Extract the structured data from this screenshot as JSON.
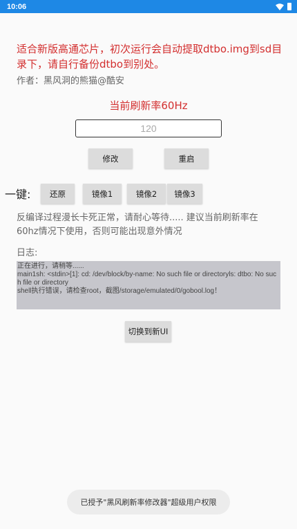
{
  "status_bar": {
    "time": "10:06",
    "wifi_icon": "wifi-icon",
    "battery_icon": "battery-icon",
    "color": "#1e88e5"
  },
  "warning": {
    "text": "适合新版高通芯片，初次运行会自动提取dtbo.img到sd目录下，请自行备份dtbo到别处。",
    "color": "#d32f2f"
  },
  "author": "作者：黑风洞的熊猫@酷安",
  "current_rate": "当前刷新率60Hz",
  "rate_input": {
    "value": "",
    "placeholder": "120"
  },
  "buttons": {
    "modify": "修改",
    "reboot": "重启",
    "restore": "还原",
    "mirror1": "镜像1",
    "mirror2": "镜像2",
    "mirror3": "镜像3",
    "switch_ui": "切换到新UI"
  },
  "onekey_label": "一键:",
  "notice": "反编译过程漫长卡死正常，请耐心等待..... 建议当前刷新率在60hz情况下使用，否则可能出现意外情况",
  "log": {
    "label": "日志:",
    "lines": [
      "正在进行，请稍等......",
      "main1sh: <stdin>[1]: cd: /dev/block/by-name: No such file or directoryls: dtbo: No such file or directory",
      "shell执行错误，请检查root，截图/storage/emulated/0/gobool.log！"
    ]
  },
  "toast": "已授予\"黑风刷新率修改器\"超级用户权限"
}
